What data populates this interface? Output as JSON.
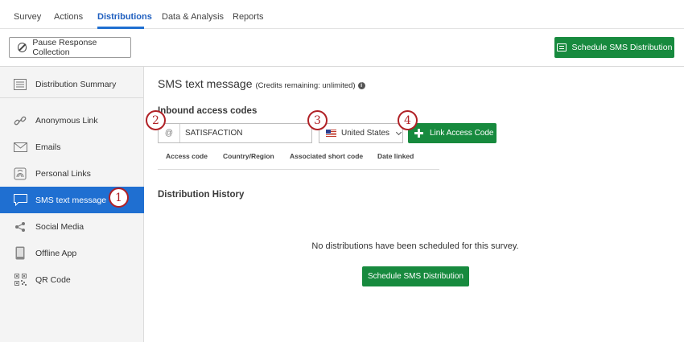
{
  "nav": {
    "tabs": [
      {
        "label": "Survey"
      },
      {
        "label": "Actions"
      },
      {
        "label": "Distributions"
      },
      {
        "label": "Data & Analysis"
      },
      {
        "label": "Reports"
      }
    ],
    "active_tab": "Distributions"
  },
  "actionbar": {
    "pause_label": "Pause Response Collection",
    "schedule_label": "Schedule SMS Distribution"
  },
  "sidebar": {
    "items": [
      {
        "label": "Distribution Summary",
        "icon": "list-icon"
      },
      {
        "label": "Anonymous Link",
        "icon": "link-icon"
      },
      {
        "label": "Emails",
        "icon": "envelope-icon"
      },
      {
        "label": "Personal Links",
        "icon": "fingerprint-icon"
      },
      {
        "label": "SMS text message",
        "icon": "chat-icon"
      },
      {
        "label": "Social Media",
        "icon": "share-icon"
      },
      {
        "label": "Offline App",
        "icon": "tablet-icon"
      },
      {
        "label": "QR Code",
        "icon": "qr-code-icon"
      }
    ],
    "active_item": "SMS text message"
  },
  "main": {
    "title": "SMS text message",
    "credits": "(Credits remaining: unlimited)",
    "inbound_title": "Inbound access codes",
    "at_prefix": "@",
    "access_code_value": "SATISFACTION",
    "country_value": "United States",
    "link_button_label": "Link Access Code",
    "columns": [
      "Access code",
      "Country/Region",
      "Associated short code",
      "Date linked"
    ],
    "history_title": "Distribution History",
    "empty_message": "No distributions have been scheduled for this survey.",
    "schedule_button_label": "Schedule SMS Distribution"
  },
  "callouts": [
    "1",
    "2",
    "3",
    "4"
  ],
  "colors": {
    "accent_blue": "#1f6fd1",
    "action_green": "#178a3e",
    "callout_red": "#b02126"
  }
}
